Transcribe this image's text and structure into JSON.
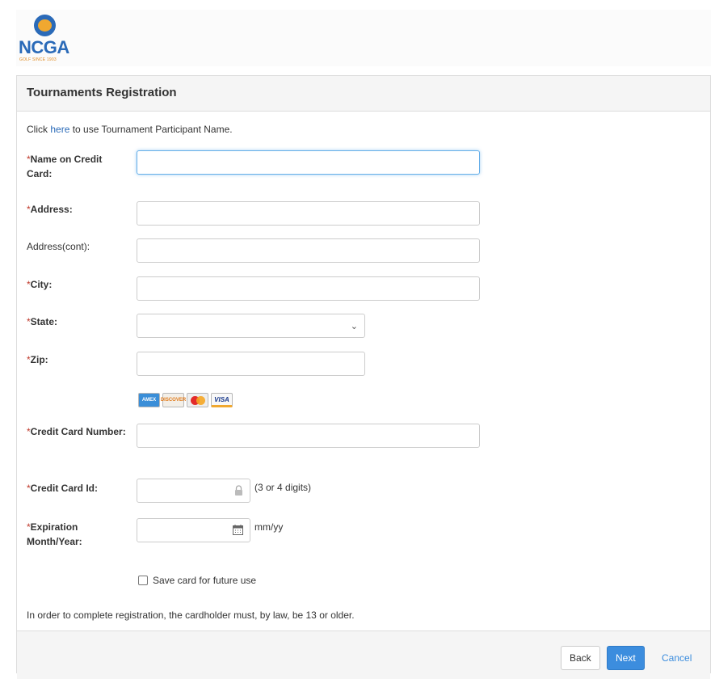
{
  "logo": {
    "text": "NCGA",
    "tagline": "GOLF SINCE 1903"
  },
  "panel": {
    "title": "Tournaments Registration"
  },
  "notice": {
    "prefix": "Click ",
    "link": "here",
    "suffix": " to use Tournament Participant Name."
  },
  "fields": {
    "name_on_card": {
      "label": "Name on Credit Card:",
      "value": ""
    },
    "address": {
      "label": "Address:",
      "value": ""
    },
    "address_cont": {
      "label": "Address(cont):",
      "value": ""
    },
    "city": {
      "label": "City:",
      "value": ""
    },
    "state": {
      "label": "State:",
      "value": ""
    },
    "zip": {
      "label": "Zip:",
      "value": ""
    },
    "card_number": {
      "label": "Credit Card Number:",
      "value": ""
    },
    "card_id": {
      "label": "Credit Card Id:",
      "value": "",
      "hint": "(3 or 4 digits)"
    },
    "expiration": {
      "label": "Expiration Month/Year:",
      "value": "",
      "hint": "mm/yy"
    }
  },
  "required_marker": "*",
  "card_icons": [
    "AMEX",
    "DISCOVER",
    "MASTERCARD",
    "VISA"
  ],
  "save_card": {
    "label": "Save card for future use",
    "checked": false
  },
  "legal": "In order to complete registration, the cardholder must, by law, be 13 or older.",
  "buttons": {
    "back": "Back",
    "next": "Next",
    "cancel": "Cancel"
  },
  "colors": {
    "accent": "#3c8dde",
    "required": "#c0392b",
    "brand": "#2a6ab8"
  }
}
